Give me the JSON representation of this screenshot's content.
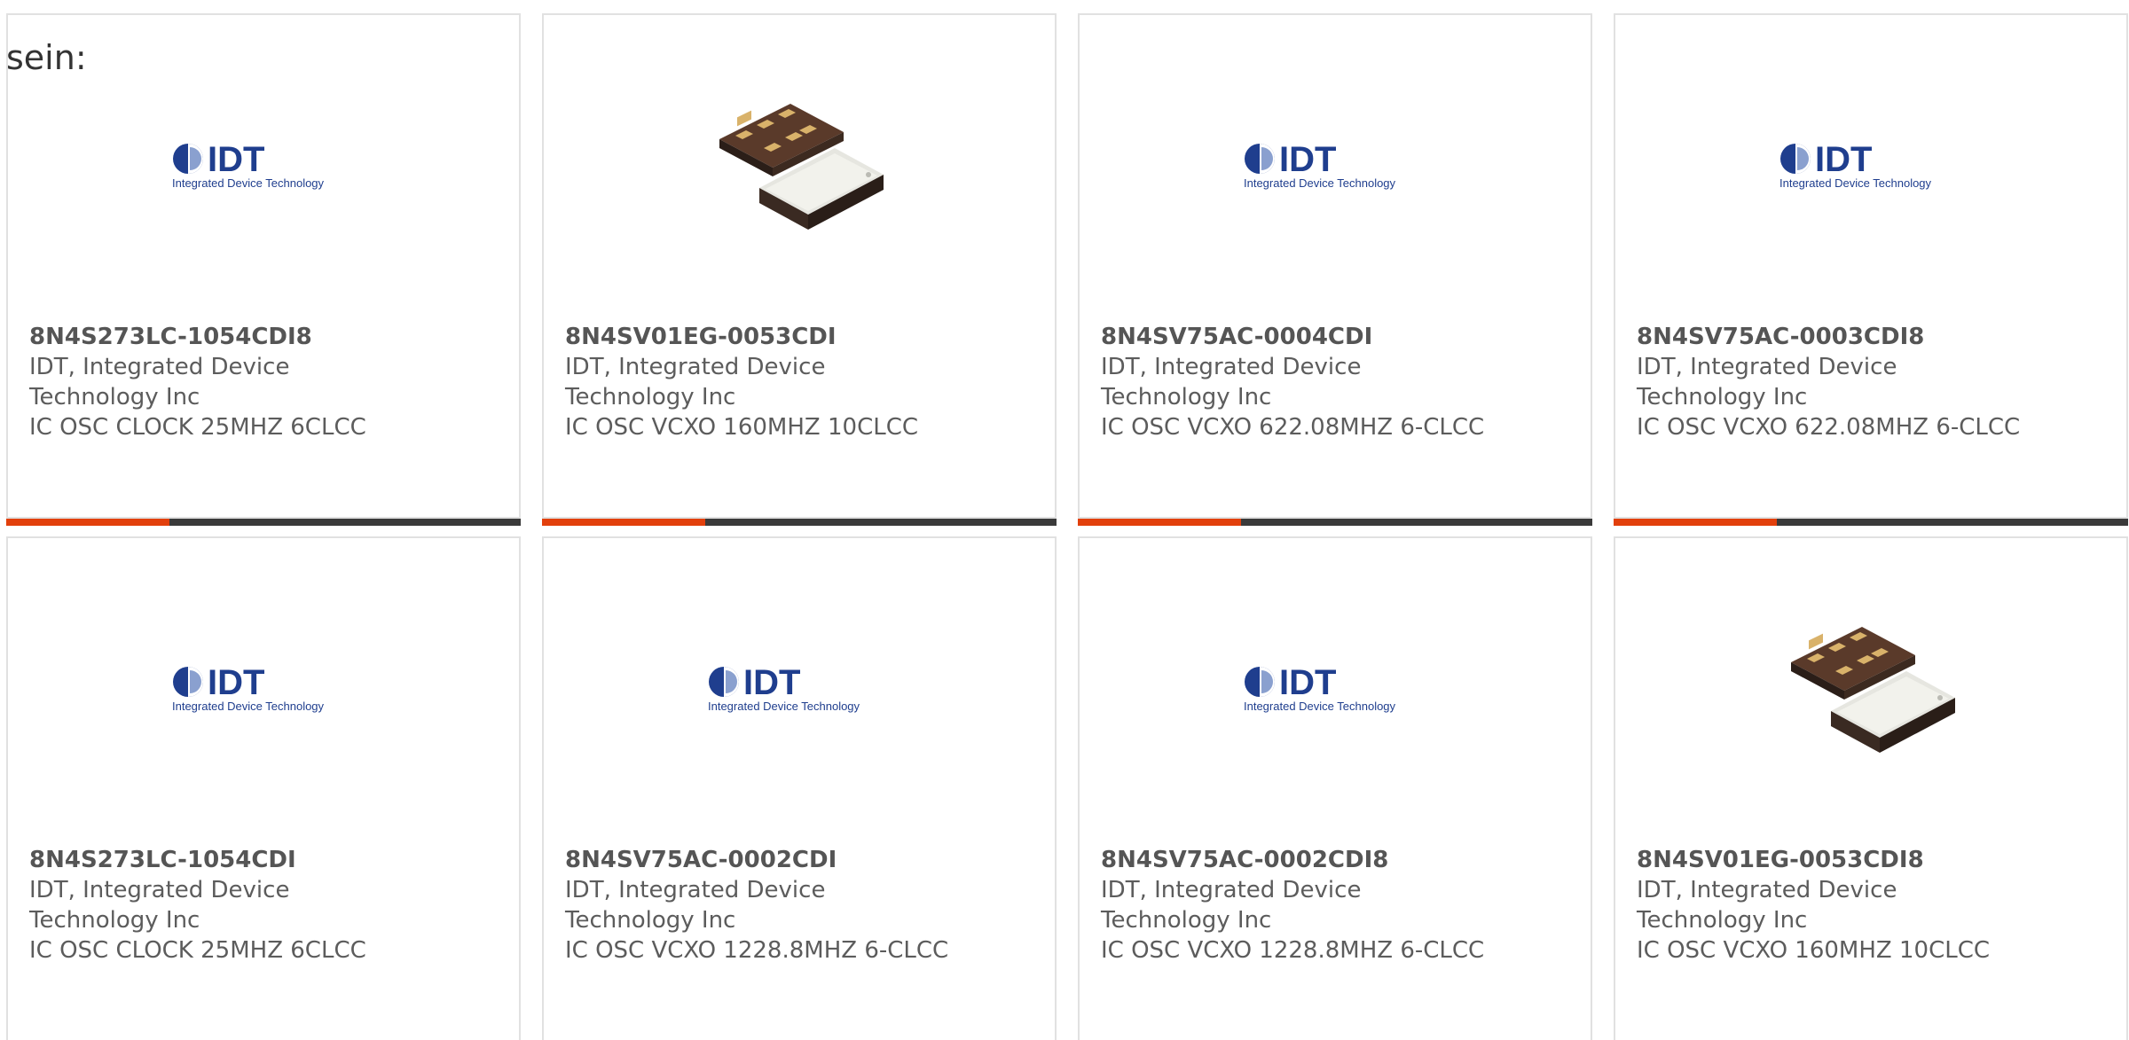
{
  "intro_text": "sein:",
  "colors": {
    "accent": "#e2400c",
    "bar": "#3a3a3a",
    "logo_blue": "#1f3e8e"
  },
  "logo": {
    "main": "IDT",
    "sub": "Integrated Device Technology"
  },
  "products": [
    {
      "part": "8N4S273LC-1054CDI8",
      "mfr": "IDT, Integrated Device Technology Inc",
      "desc": "IC OSC CLOCK 25MHZ 6CLCC",
      "image": "idt-logo"
    },
    {
      "part": "8N4SV01EG-0053CDI",
      "mfr": "IDT, Integrated Device Technology Inc",
      "desc": "IC OSC VCXO 160MHZ 10CLCC",
      "image": "chip-photo"
    },
    {
      "part": "8N4SV75AC-0004CDI",
      "mfr": "IDT, Integrated Device Technology Inc",
      "desc": "IC OSC VCXO 622.08MHZ 6-CLCC",
      "image": "idt-logo"
    },
    {
      "part": "8N4SV75AC-0003CDI8",
      "mfr": "IDT, Integrated Device Technology Inc",
      "desc": "IC OSC VCXO 622.08MHZ 6-CLCC",
      "image": "idt-logo"
    },
    {
      "part": "8N4S273LC-1054CDI",
      "mfr": "IDT, Integrated Device Technology Inc",
      "desc": "IC OSC CLOCK 25MHZ 6CLCC",
      "image": "idt-logo"
    },
    {
      "part": "8N4SV75AC-0002CDI",
      "mfr": "IDT, Integrated Device Technology Inc",
      "desc": "IC OSC VCXO 1228.8MHZ 6-CLCC",
      "image": "idt-logo"
    },
    {
      "part": "8N4SV75AC-0002CDI8",
      "mfr": "IDT, Integrated Device Technology Inc",
      "desc": "IC OSC VCXO 1228.8MHZ 6-CLCC",
      "image": "idt-logo"
    },
    {
      "part": "8N4SV01EG-0053CDI8",
      "mfr": "IDT, Integrated Device Technology Inc",
      "desc": "IC OSC VCXO 160MHZ 10CLCC",
      "image": "chip-photo"
    }
  ]
}
